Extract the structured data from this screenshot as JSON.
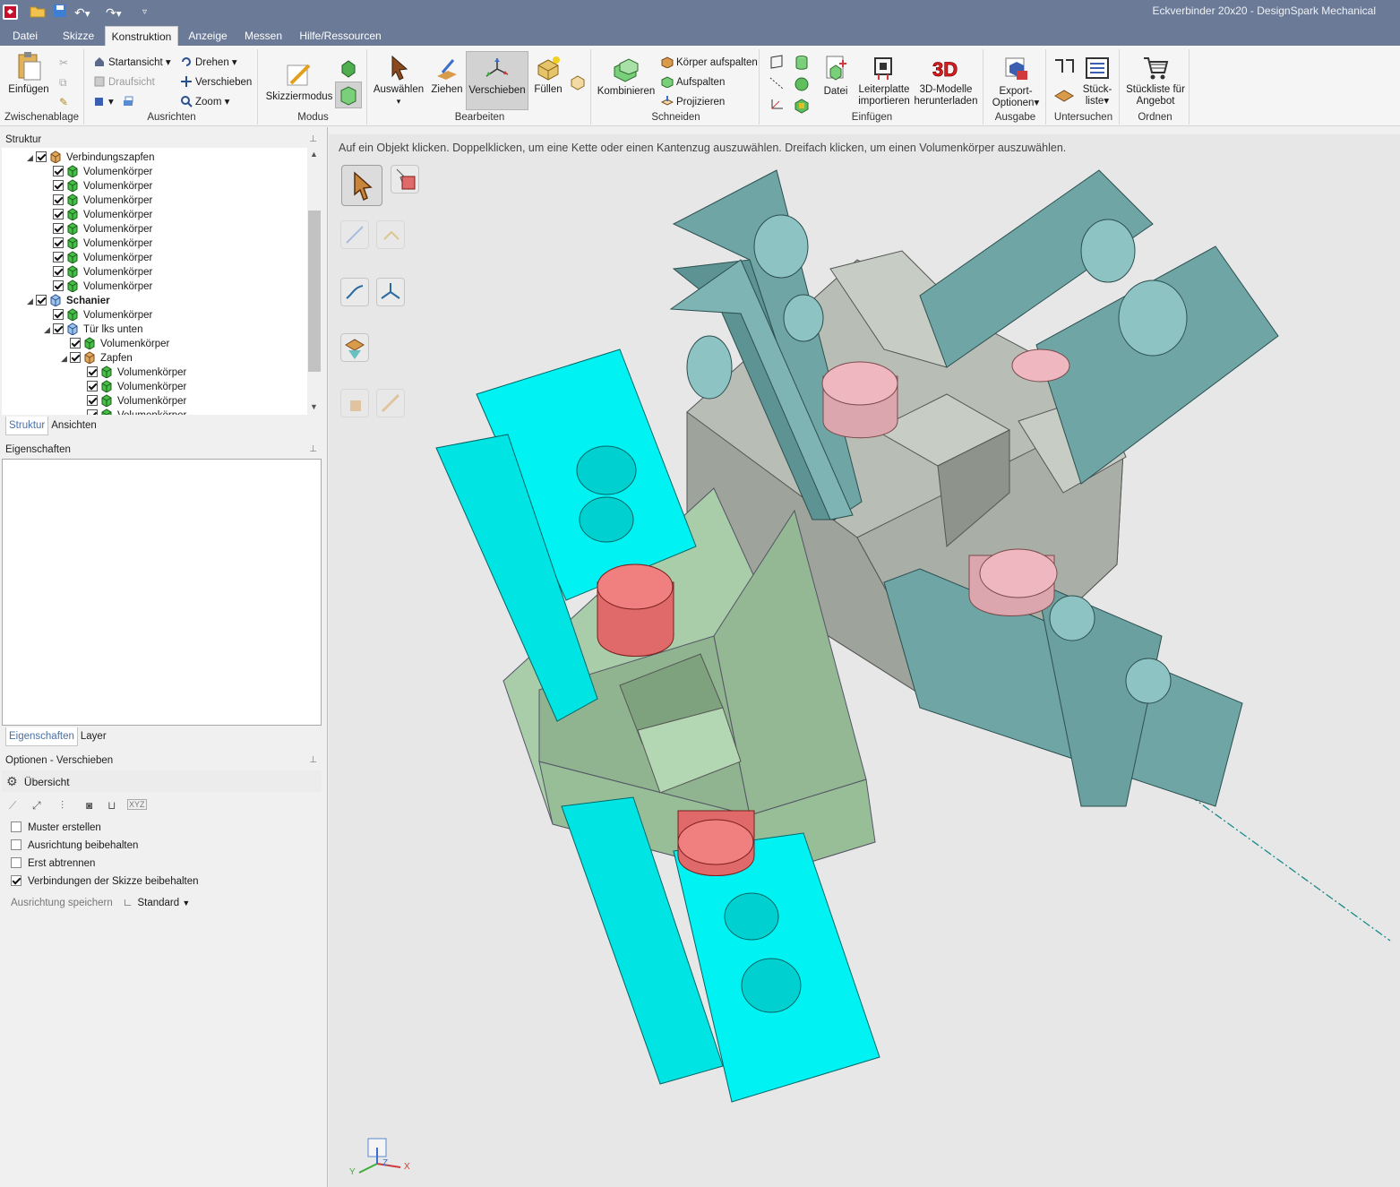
{
  "app": {
    "title": "Eckverbinder 20x20 - DesignSpark Mechanical"
  },
  "menu": {
    "tabs": [
      "Datei",
      "Skizze",
      "Konstruktion",
      "Anzeige",
      "Messen",
      "Hilfe/Ressourcen"
    ],
    "active": "Konstruktion"
  },
  "ribbon": {
    "zwischenablage": {
      "label": "Zwischenablage",
      "einfuegen": "Einfügen"
    },
    "ausrichten": {
      "label": "Ausrichten",
      "startansicht": "Startansicht",
      "draufsicht": "Draufsicht",
      "drehen": "Drehen",
      "verschieben": "Verschieben",
      "zoom": "Zoom"
    },
    "modus": {
      "label": "Modus",
      "skizziermodus": "Skizziermodus"
    },
    "bearbeiten": {
      "label": "Bearbeiten",
      "auswaehlen": "Auswählen",
      "ziehen": "Ziehen",
      "verschieben": "Verschieben",
      "fuellen": "Füllen"
    },
    "schneiden": {
      "label": "Schneiden",
      "kombinieren": "Kombinieren",
      "koerper_aufspalten": "Körper aufspalten",
      "aufspalten": "Aufspalten",
      "projizieren": "Projizieren"
    },
    "einfuegen": {
      "label": "Einfügen",
      "datei": "Datei",
      "leiterplatte_1": "Leiterplatte",
      "leiterplatte_2": "importieren",
      "modelle_1": "3D-Modelle",
      "modelle_2": "herunterladen"
    },
    "ausgabe": {
      "label": "Ausgabe",
      "export_1": "Export-",
      "export_2": "Optionen"
    },
    "untersuchen": {
      "label": "Untersuchen",
      "stueck_1": "Stück-",
      "stueck_2": "liste"
    },
    "ordnen": {
      "label": "Ordnen",
      "stueckliste_1": "Stückliste für",
      "stueckliste_2": "Angebot"
    }
  },
  "struktur": {
    "title": "Struktur",
    "tree": [
      {
        "label": "Verbindungszapfen",
        "level": 0,
        "checked": true,
        "expanded": true,
        "type": "component",
        "bold": false
      },
      {
        "label": "Volumenkörper",
        "level": 1,
        "checked": true,
        "type": "body"
      },
      {
        "label": "Volumenkörper",
        "level": 1,
        "checked": true,
        "type": "body"
      },
      {
        "label": "Volumenkörper",
        "level": 1,
        "checked": true,
        "type": "body"
      },
      {
        "label": "Volumenkörper",
        "level": 1,
        "checked": true,
        "type": "body"
      },
      {
        "label": "Volumenkörper",
        "level": 1,
        "checked": true,
        "type": "body"
      },
      {
        "label": "Volumenkörper",
        "level": 1,
        "checked": true,
        "type": "body"
      },
      {
        "label": "Volumenkörper",
        "level": 1,
        "checked": true,
        "type": "body"
      },
      {
        "label": "Volumenkörper",
        "level": 1,
        "checked": true,
        "type": "body"
      },
      {
        "label": "Volumenkörper",
        "level": 1,
        "checked": true,
        "type": "body"
      },
      {
        "label": "Schanier",
        "level": 0,
        "checked": true,
        "expanded": true,
        "type": "assembly",
        "bold": true
      },
      {
        "label": "Volumenkörper",
        "level": 1,
        "checked": true,
        "type": "body"
      },
      {
        "label": "Tür lks unten",
        "level": 1,
        "checked": true,
        "expanded": true,
        "type": "assembly"
      },
      {
        "label": "Volumenkörper",
        "level": 2,
        "checked": true,
        "type": "body"
      },
      {
        "label": "Zapfen",
        "level": 2,
        "checked": true,
        "expanded": true,
        "type": "component"
      },
      {
        "label": "Volumenkörper",
        "level": 3,
        "checked": true,
        "type": "body"
      },
      {
        "label": "Volumenkörper",
        "level": 3,
        "checked": true,
        "type": "body"
      },
      {
        "label": "Volumenkörper",
        "level": 3,
        "checked": true,
        "type": "body"
      },
      {
        "label": "Volumenkörper",
        "level": 3,
        "checked": true,
        "type": "body"
      }
    ],
    "tabs": [
      "Struktur",
      "Ansichten"
    ]
  },
  "eigenschaften": {
    "title": "Eigenschaften",
    "tabs": [
      "Eigenschaften",
      "Layer"
    ]
  },
  "optionen": {
    "title": "Optionen - Verschieben",
    "uebersicht": "Übersicht",
    "checkboxes": [
      {
        "label": "Muster erstellen",
        "checked": false
      },
      {
        "label": "Ausrichtung beibehalten",
        "checked": false
      },
      {
        "label": "Erst abtrennen",
        "checked": false
      },
      {
        "label": "Verbindungen der Skizze beibehalten",
        "checked": true
      }
    ],
    "ausrichtung_label": "Ausrichtung speichern",
    "ausrichtung_value": "Standard"
  },
  "viewport": {
    "hint": "Auf ein Objekt klicken.  Doppelklicken, um eine Kette oder einen Kantenzug auszuwählen.  Dreifach klicken, um einen Volumenkörper auszuwählen.",
    "triad": {
      "x": "X",
      "y": "Y",
      "z": "Z"
    }
  },
  "colors": {
    "titlebar": "#6b7a96",
    "cyan": "#00f2f2",
    "teal": "#6fa5a5",
    "green": "#a8cda8",
    "gray": "#b8bdb6",
    "pink": "#efb7bf",
    "red": "#f07f7f"
  }
}
